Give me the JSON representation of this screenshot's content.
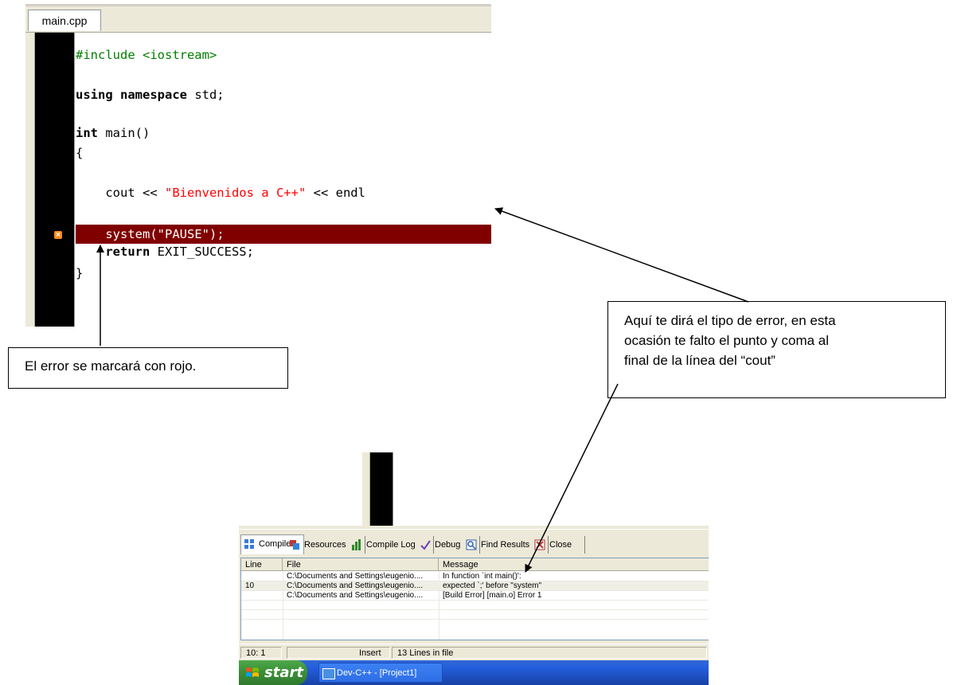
{
  "editor": {
    "tab_label": "main.cpp",
    "code": {
      "line1_include": "#include <iostream>",
      "line2_kw": "using namespace",
      "line2_rest": " std;",
      "line3_kw": "int",
      "line3_rest": " main()",
      "line4": "{",
      "line5_pre": "    cout << ",
      "line5_str": "\"Bienvenidos a C++\"",
      "line5_post": " << endl",
      "line6_pre": "    system(",
      "line6_str": "\"PAUSE\"",
      "line6_post": ");",
      "line7_kw": "return",
      "line7_rest": " EXIT_SUCCESS;",
      "line8": "}"
    },
    "error_icon": "error-marker-icon",
    "error_highlight_color": "#800000"
  },
  "callouts": {
    "left": "El error se marcará con rojo.",
    "right_line1": "Aquí te dirá el tipo de error, en esta",
    "right_line2": "ocasión te falto el  punto y coma al",
    "right_line3": "final de la línea del “cout”"
  },
  "bottom_panel": {
    "tabs": [
      {
        "label": "Compiler",
        "icon": "compiler-grid-icon"
      },
      {
        "label": "Resources",
        "icon": "resources-icon"
      },
      {
        "label": "Compile Log",
        "icon": "compile-log-chart-icon"
      },
      {
        "label": "Debug",
        "icon": "debug-check-icon"
      },
      {
        "label": "Find Results",
        "icon": "find-results-magnifier-icon"
      },
      {
        "label": "Close",
        "icon": "close-icon"
      }
    ],
    "columns": [
      "Line",
      "File",
      "Message"
    ],
    "rows": [
      {
        "line": "",
        "file": "C:\\Documents and Settings\\eugenio....",
        "message": "In function `int main()':"
      },
      {
        "line": "10",
        "file": "C:\\Documents and Settings\\eugenio....",
        "message": "expected `;' before \"system\""
      },
      {
        "line": "",
        "file": "C:\\Documents and Settings\\eugenio....",
        "message": "[Build Error]  [main.o] Error 1"
      }
    ]
  },
  "status_bar": {
    "position": "10: 1",
    "mode": "Insert",
    "lines": "13 Lines in file"
  },
  "taskbar": {
    "start_label": "start",
    "window_button": "Dev-C++ - [Project1]"
  }
}
